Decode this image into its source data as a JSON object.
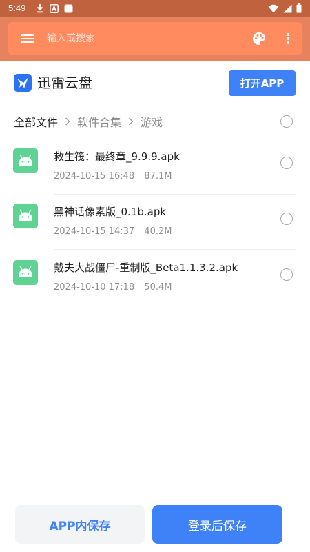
{
  "status_bar": {
    "time": "5:49",
    "left_icons": [
      "download-icon",
      "a-box-icon",
      "square-icon"
    ],
    "right_icons": [
      "wifi-icon",
      "signal-icon",
      "battery-icon"
    ]
  },
  "search": {
    "placeholder": "输入或搜索"
  },
  "brand": {
    "name": "迅雷云盘"
  },
  "actions": {
    "open_app": "打开APP",
    "save_in_app": "APP内保存",
    "login_save": "登录后保存"
  },
  "breadcrumb": [
    "全部文件",
    "软件合集",
    "游戏"
  ],
  "files": [
    {
      "name": "救生筏：最终章_9.9.9.apk",
      "date": "2024-10-15 16:48",
      "size": "87.1M"
    },
    {
      "name": "黑神话像素版_0.1b.apk",
      "date": "2024-10-15 14:37",
      "size": "40.2M"
    },
    {
      "name": "戴夫大战僵尸-重制版_Beta1.1.3.2.apk",
      "date": "2024-10-10 17:18",
      "size": "50.4M"
    }
  ],
  "colors": {
    "status_bar": "#c1623f",
    "app_bar": "#e7825e",
    "search_bar": "#ff8b5f",
    "accent_blue": "#3f82f7",
    "android_icon": "#5fd394"
  }
}
